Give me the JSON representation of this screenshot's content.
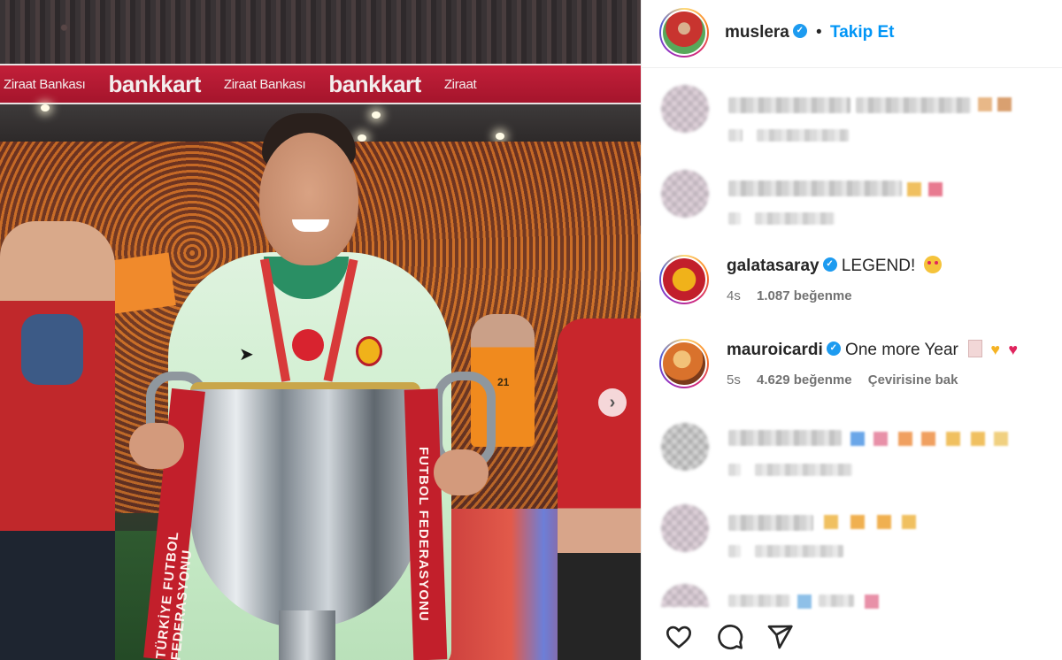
{
  "photo": {
    "banner_texts": [
      "Ziraat Bankası",
      "bankkart",
      "Ziraat Bankası",
      "bankkart",
      "Ziraat"
    ],
    "ribbon_left_text": "TÜRKİYE FUTBOL FEDERASYONU",
    "ribbon_right_text": "FUTBOL FEDERASYONU",
    "steward_vest_text": "21",
    "next_icon": "chevron-right-icon"
  },
  "post": {
    "author": {
      "username": "muslera",
      "verified": true,
      "separator": "•",
      "follow_label": "Takip Et"
    }
  },
  "comments": [
    {
      "username": "galatasaray",
      "verified": true,
      "text": "LEGEND!",
      "emoji": "heart-eyes-emoji",
      "time": "4s",
      "likes": "1.087 beğenme"
    },
    {
      "username": "mauroicardi",
      "verified": true,
      "text": "One more Year",
      "emoji": [
        "memo-emoji",
        "yellow-heart-emoji",
        "red-heart-emoji"
      ],
      "time": "5s",
      "likes": "4.629 beğenme",
      "translate_label": "Çevirisine bak"
    }
  ],
  "actions": [
    "heart-icon",
    "comment-icon",
    "share-icon"
  ],
  "colors": {
    "link_blue": "#0095f6",
    "verified_blue": "#1d9bf0",
    "text_primary": "#262626",
    "text_secondary": "#737373",
    "galatasaray_red": "#c21f2b",
    "galatasaray_yellow": "#f0b21a"
  }
}
